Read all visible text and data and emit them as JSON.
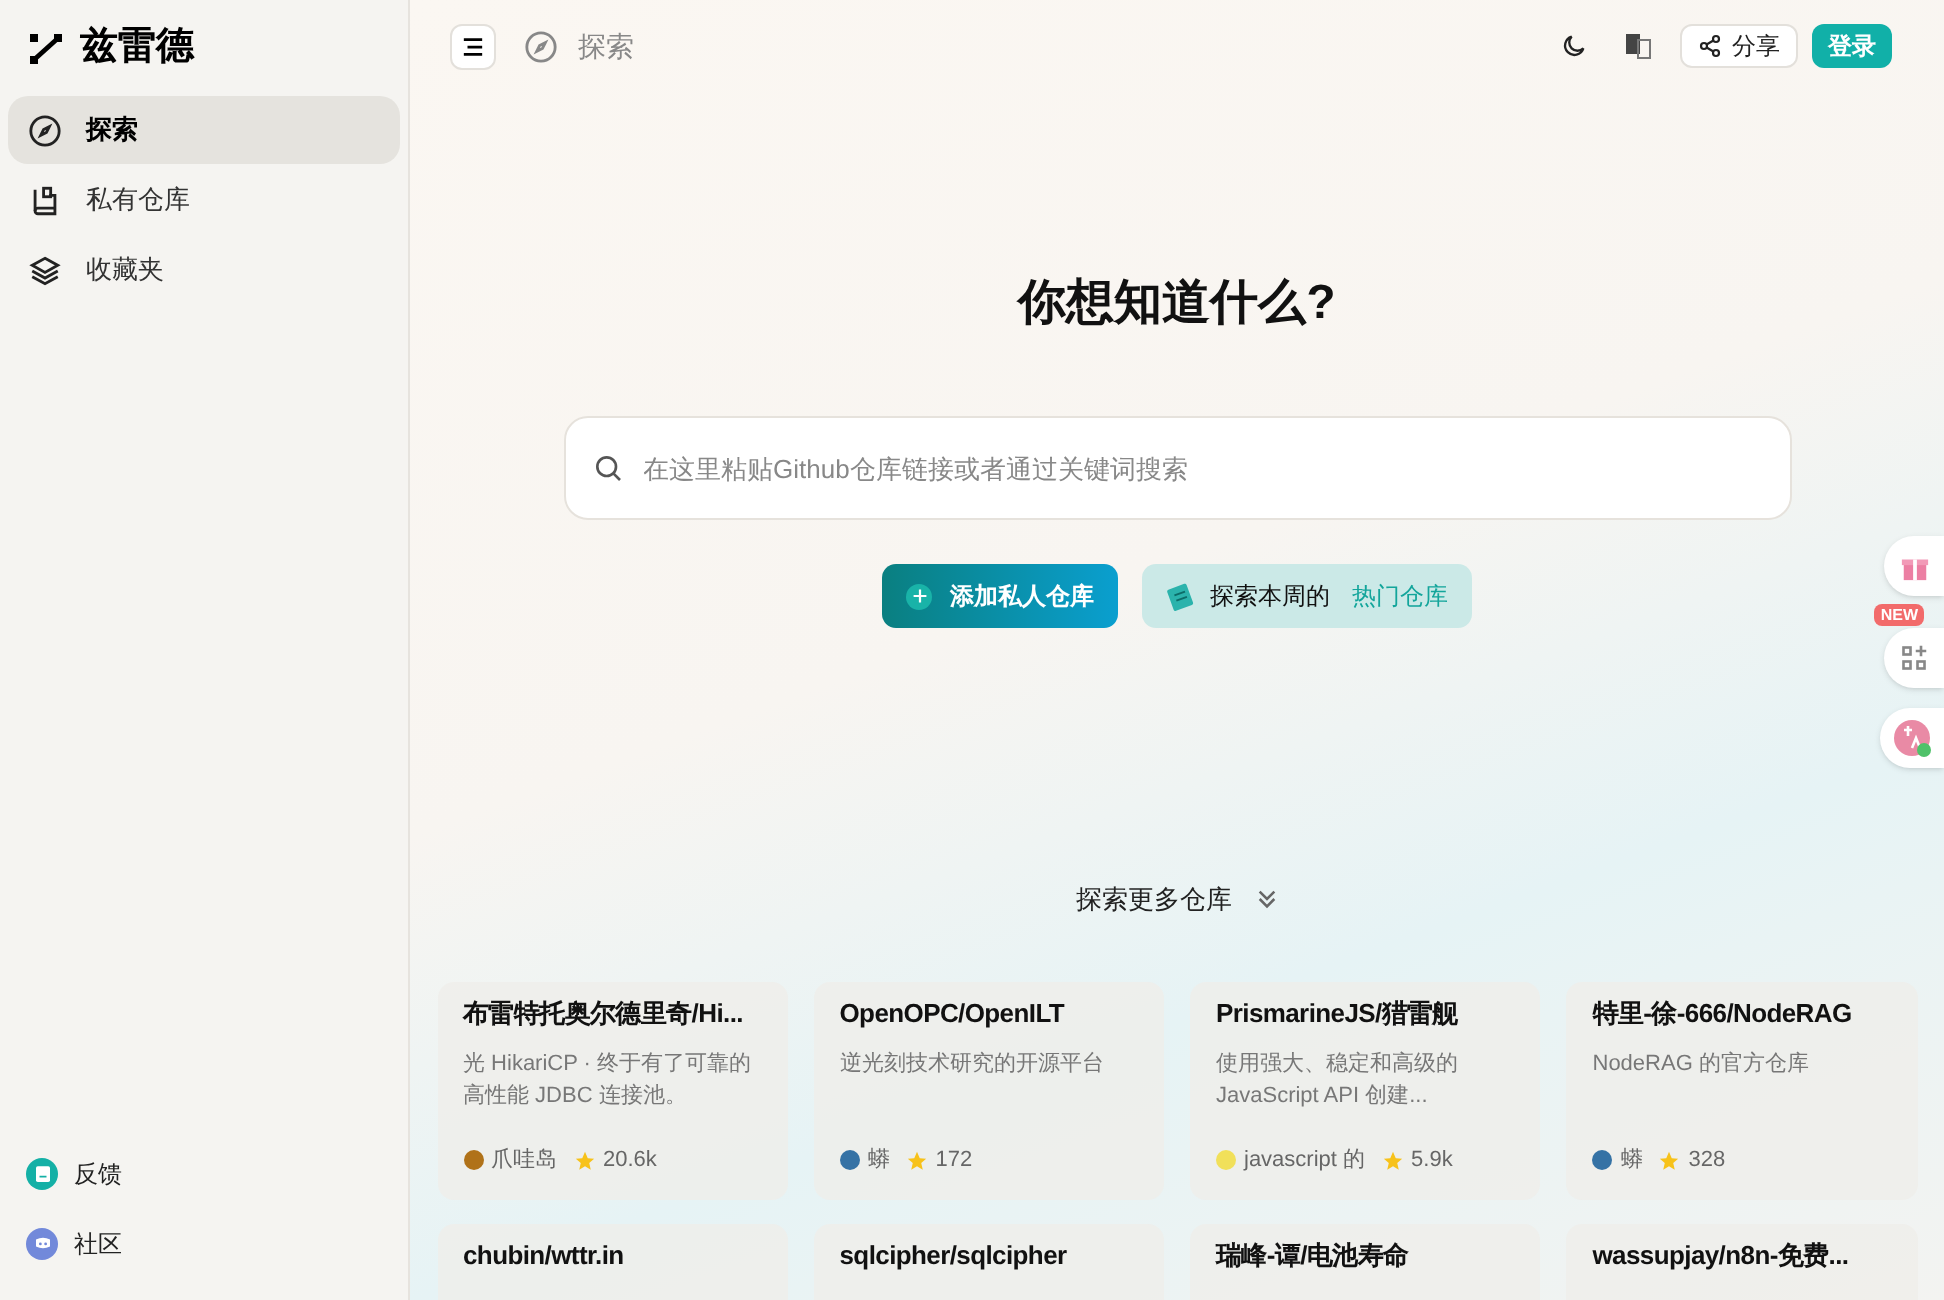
{
  "brand": {
    "name": "兹雷德"
  },
  "sidebar": {
    "items": [
      {
        "label": "探索",
        "selected": true
      },
      {
        "label": "私有仓库",
        "selected": false
      },
      {
        "label": "收藏夹",
        "selected": false
      }
    ],
    "footer": [
      {
        "label": "反馈"
      },
      {
        "label": "社区"
      }
    ]
  },
  "header": {
    "breadcrumb": "探索",
    "share": "分享",
    "login": "登录"
  },
  "hero": {
    "title": "你想知道什么?",
    "search_placeholder": "在这里粘贴Github仓库链接或者通过关键词搜索",
    "add_button": "添加私人仓库",
    "explore_prefix": "探索本周的",
    "explore_link": "热门仓库"
  },
  "more": "探索更多仓库",
  "side_widgets": {
    "new_badge": "NEW"
  },
  "cards": [
    {
      "title": "布雷特托奥尔德里奇/Hi...",
      "description": "光 HikariCP · 终于有了可靠的高性能 JDBC 连接池。",
      "language": "爪哇岛",
      "color": "#b07219",
      "stars": "20.6k"
    },
    {
      "title": "OpenOPC/OpenILT",
      "description": "逆光刻技术研究的开源平台",
      "language": "蟒",
      "color": "#3572a5",
      "stars": "172"
    },
    {
      "title": "PrismarineJS/猎雷舰",
      "description": "使用强大、稳定和高级的 JavaScript API 创建...",
      "language": "javascript 的",
      "color": "#f1e05a",
      "stars": "5.9k"
    },
    {
      "title": "特里-徐-666/NodeRAG",
      "description": "NodeRAG 的官方仓库",
      "language": "蟒",
      "color": "#3572a5",
      "stars": "328"
    },
    {
      "title": "chubin/wttr.in"
    },
    {
      "title": "sqlcipher/sqlcipher"
    },
    {
      "title": "瑞峰-谭/电池寿命"
    },
    {
      "title": "wassupjay/n8n-免费..."
    }
  ]
}
